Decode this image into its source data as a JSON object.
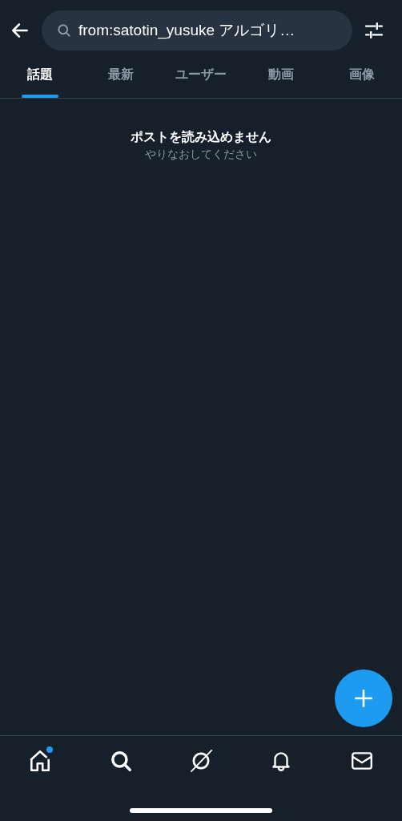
{
  "search": {
    "value": "from:satotin_yusuke アルゴリ…"
  },
  "tabs": [
    {
      "label": "話題",
      "selected": true
    },
    {
      "label": "最新",
      "selected": false
    },
    {
      "label": "ユーザー",
      "selected": false
    },
    {
      "label": "動画",
      "selected": false
    },
    {
      "label": "画像",
      "selected": false
    }
  ],
  "message": {
    "title": "ポストを読み込めません",
    "subtitle": "やりなおしてください"
  },
  "nav": [
    {
      "kind": "home",
      "badge": true
    },
    {
      "kind": "search",
      "badge": false
    },
    {
      "kind": "grok",
      "badge": false
    },
    {
      "kind": "notifications",
      "badge": false
    },
    {
      "kind": "messages",
      "badge": false
    }
  ]
}
